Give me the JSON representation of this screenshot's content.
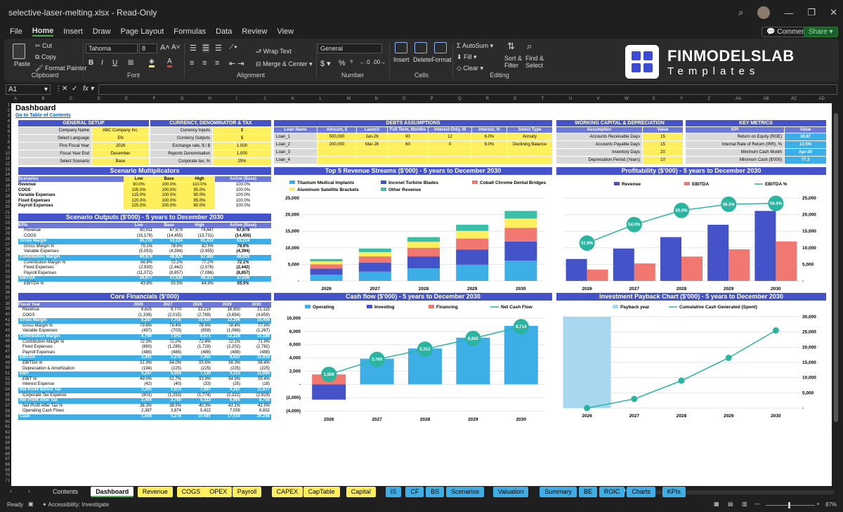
{
  "window": {
    "title": "selective-laser-melting.xlsx  -  Read-Only"
  },
  "menu": [
    "File",
    "Home",
    "Insert",
    "Draw",
    "Page Layout",
    "Formulas",
    "Data",
    "Review",
    "View"
  ],
  "menu_right": {
    "comments": "Comments",
    "share": "Share"
  },
  "ribbon": {
    "paste": "Paste",
    "cut": "Cut",
    "copy": "Copy",
    "format_painter": "Format Painter",
    "clipboard": "Clipboard",
    "font_name": "Tahoma",
    "font_size": "8",
    "font": "Font",
    "wrap": "Wrap Text",
    "merge": "Merge & Center",
    "alignment": "Alignment",
    "number_format": "General",
    "number": "Number",
    "insert": "Insert",
    "delete": "Delete",
    "format": "Format",
    "cells": "Cells",
    "autosum": "AutoSum",
    "fill": "Fill",
    "clear": "Clear",
    "sort": "Sort &",
    "filter": "Filter",
    "find": "Find &",
    "select": "Select",
    "editing": "Editing"
  },
  "logo": {
    "line1": "FINMODELSLAB",
    "line2": "Templates"
  },
  "formula": {
    "namebox": "A1"
  },
  "columns": [
    "A",
    "B",
    "C",
    "D",
    "E",
    "F",
    "G",
    "H",
    "I",
    "J",
    "K",
    "L",
    "M",
    "N",
    "O",
    "P",
    "Q",
    "R",
    "S",
    "T",
    "U",
    "V",
    "W",
    "X",
    "Y",
    "Z",
    "AA",
    "AB",
    "AC",
    "AD"
  ],
  "dashboard": {
    "title": "Dashboard",
    "toc": "Go to Table of Contents"
  },
  "general_setup": {
    "title": "GENERAL SETUP",
    "rows": [
      [
        "Company Name",
        "ABC Company Inc."
      ],
      [
        "Select Language",
        "EN"
      ],
      [
        "First Fiscal Year",
        "2026"
      ],
      [
        "Fiscal Year End",
        "December"
      ],
      [
        "Select Scenario",
        "Base"
      ]
    ]
  },
  "currency": {
    "title": "CURRENCY, DENOMINATOR & TAX",
    "rows": [
      [
        "Currency Inputs",
        "$"
      ],
      [
        "Currency Outputs",
        "$"
      ],
      [
        "Exchange rate, $ / $",
        "1.000"
      ],
      [
        "Reports Denomination",
        "1,000"
      ],
      [
        "Corporate tax, %",
        "25%"
      ]
    ]
  },
  "debts": {
    "title": "DEBTS ASSUMPTIONS",
    "headers": [
      "Loan Name",
      "Amount, $",
      "Launch",
      "Full Term, Months",
      "Interest-Only, M",
      "Interest, %",
      "Select Type"
    ],
    "rows": [
      [
        "Loan_1",
        "500,000",
        "Jan-26",
        "90",
        "12",
        "6.0%",
        "Annuity"
      ],
      [
        "Loan_2",
        "200,000",
        "Mar-26",
        "60",
        "0",
        "8.0%",
        "Declining Balance"
      ],
      [
        "Loan_3",
        "",
        "",
        "",
        "",
        "",
        ""
      ],
      [
        "Loan_4",
        "",
        "",
        "",
        "",
        "",
        ""
      ]
    ]
  },
  "working_capital": {
    "title": "WORKING CAPITAL & DEPRECIATION",
    "headers": [
      "Assumption",
      "Value"
    ],
    "rows": [
      [
        "Accounts Receivable Days",
        "15"
      ],
      [
        "Accounts Payable Days",
        "15"
      ],
      [
        "Inventory Days",
        "20"
      ],
      [
        "Depreciation Period (Years)",
        "10"
      ]
    ]
  },
  "kpis": {
    "title": "KEY METRICS",
    "headers": [
      "KPI",
      "Value"
    ],
    "rows": [
      [
        "Return on Equity (ROE)",
        "38.87"
      ],
      [
        "Internal Rate of Return (IRR), %",
        "13.5%"
      ],
      [
        "Minimum Cash Month",
        "Apr-26"
      ],
      [
        "Minimum Cash ($'000)",
        "77.3"
      ]
    ]
  },
  "multipliers": {
    "title": "Scenario Multiplicators",
    "headers": [
      "Scenarios",
      "Low",
      "Base",
      "High",
      "Active (Base)"
    ],
    "rows": [
      [
        "Revenue",
        "90.0%",
        "100.0%",
        "110.0%",
        "100.0%"
      ],
      [
        "COGS",
        "105.0%",
        "100.0%",
        "95.0%",
        "100.0%"
      ],
      [
        "Variable Expenses",
        "115.0%",
        "100.0%",
        "90.0%",
        "100.0%"
      ],
      [
        "Fixed Expenses",
        "120.0%",
        "100.0%",
        "85.0%",
        "100.0%"
      ],
      [
        "Payroll Expenses",
        "125.0%",
        "100.0%",
        "80.0%",
        "100.0%"
      ]
    ]
  },
  "outputs": {
    "title": "Scenario Outputs ($'000) - 5 years to December 2030",
    "headers": [
      "KPIs",
      "Low",
      "Base",
      "High",
      "Active (Base)"
    ],
    "rows": [
      [
        "Revenue",
        "60,911",
        "67,679",
        "74,447",
        "67,679"
      ],
      [
        "COGS",
        "(15,178)",
        "(14,455)",
        "(13,731)",
        "(14,455)"
      ],
      [
        "Gross Margin",
        "45,733",
        "53,224",
        "61,432",
        "53,224"
      ],
      [
        "Gross Margin %",
        "75.1%",
        "78.6%",
        "82.5%",
        "78.6%"
      ],
      [
        "Variable Expenses",
        "(5,053)",
        "(4,394)",
        "(3,955)",
        "(4,394)"
      ],
      [
        "Contribution Margin",
        "40,679",
        "48,829",
        "57,482",
        "48,829"
      ],
      [
        "Contribution Margin %",
        "66.8%",
        "72.1%",
        "77.2%",
        "72.1%"
      ],
      [
        "Fixed Expenses",
        "(2,930)",
        "(2,442)",
        "(2,076)",
        "(2,442)"
      ],
      [
        "Payroll Expenses",
        "(11,072)",
        "(8,857)",
        "(7,086)",
        "(8,857)"
      ],
      [
        "EBITDA",
        "26,677",
        "37,530",
        "48,321",
        "37,530"
      ],
      [
        "EBITDA %",
        "43.8%",
        "55.5%",
        "64.9%",
        "55.5%"
      ]
    ]
  },
  "core": {
    "title": "Core Financials ($'000)",
    "headers": [
      "Fiscal Year",
      "2026",
      "2027",
      "2028",
      "2029",
      "2030"
    ],
    "rows": [
      [
        "Revenue",
        "6,625",
        "9,770",
        "13,219",
        "16,950",
        "21,115"
      ],
      [
        "COGS",
        "(1,338)",
        "(2,015)",
        "(2,789)",
        "(3,654)",
        "(4,659)"
      ],
      [
        "Gross Margin",
        "5,287",
        "7,755",
        "10,430",
        "13,296",
        "16,456"
      ],
      [
        "Gross Margin %",
        "79.8%",
        "79.4%",
        "78.9%",
        "78.4%",
        "77.9%"
      ],
      [
        "Variable Expenses",
        "(497)",
        "(703)",
        "(859)",
        "(1,068)",
        "(1,267)"
      ],
      [
        "Contribution Margin",
        "4,790",
        "7,051",
        "9,571",
        "12,228",
        "15,189"
      ],
      [
        "Contribution Margin %",
        "72.3%",
        "72.2%",
        "72.4%",
        "72.1%",
        "71.9%"
      ],
      [
        "Fixed Expenses",
        "(860)",
        "(1,285)",
        "(1,728)",
        "(2,202)",
        "(2,782)"
      ],
      [
        "Payroll Expenses",
        "(488)",
        "(488)",
        "(488)",
        "(488)",
        "(488)"
      ],
      [
        "EBITDA",
        "3,441",
        "5,278",
        "7,355",
        "9,537",
        "11,918"
      ],
      [
        "EBITDA %",
        "51.9%",
        "54.0%",
        "55.6%",
        "56.3%",
        "56.4%"
      ],
      [
        "Depreciation & Amortization",
        "(194)",
        "(225)",
        "(225)",
        "(225)",
        "(225)"
      ],
      [
        "EBIT",
        "3,247",
        "5,054",
        "7,130",
        "9,313",
        "11,694"
      ],
      [
        "EBIT %",
        "49.0%",
        "51.7%",
        "53.9%",
        "54.9%",
        "55.4%"
      ],
      [
        "Interest Expense",
        "(42)",
        "(40)",
        "(33)",
        "(25)",
        "(18)"
      ],
      [
        "Net Profit Before Tax",
        "3,205",
        "5,013",
        "7,097",
        "9,287",
        "11,677"
      ],
      [
        "Corporate Tax Expense",
        "(801)",
        "(1,253)",
        "(1,774)",
        "(2,322)",
        "(2,919)"
      ],
      [
        "Net Profit After Tax",
        "2,404",
        "3,760",
        "5,323",
        "6,965",
        "8,758"
      ],
      [
        "Net Profit After Tax %",
        "36.3%",
        "38.5%",
        "40.3%",
        "41.1%",
        "41.5%"
      ],
      [
        "Operating Cash Flows",
        "2,387",
        "3,874",
        "5,422",
        "7,055",
        "8,832"
      ],
      [
        "Cash",
        "1,508",
        "5,278",
        "10,591",
        "17,533",
        "26,248"
      ]
    ]
  },
  "charts": {
    "revenue": {
      "title": "Top 5 Revenue Streams ($'000) - 5 years to December 2030",
      "legend": [
        "Titanium Medical Implants",
        "Inconel Turbine Blades",
        "Cobalt Chrome Dental Bridges",
        "Aluminum Satellite Brackets",
        "Other Revenue"
      ],
      "colors": [
        "#3eaee6",
        "#4453c8",
        "#f07870",
        "#ffef5c",
        "#3bbfa8"
      ]
    },
    "profit": {
      "title": "Profitability ($'000) - 5 years to December 2030",
      "legend": [
        "Revenue",
        "EBITDA",
        "EBITDA %"
      ],
      "colors": [
        "#4453c8",
        "#f07870",
        "#2bb5a0"
      ]
    },
    "cash": {
      "title": "Cash flow ($'000) - 5 years to December 2030",
      "legend": [
        "Operating",
        "Investing",
        "Financing",
        "Net Cash Flow"
      ],
      "colors": [
        "#3eaee6",
        "#4453c8",
        "#f07870",
        "#2bb5a0"
      ]
    },
    "payback": {
      "title": "Investment Payback Chart ($'000) - 5 years to December 2030",
      "legend": [
        "Payback year",
        "Cumulative Cash Generated (Spent)"
      ],
      "colors": [
        "#a8d8f0",
        "#2bb5a0"
      ]
    }
  },
  "chart_data": [
    {
      "type": "bar",
      "title": "Top 5 Revenue Streams ($'000) - 5 years to December 2030",
      "categories": [
        "2026",
        "2027",
        "2028",
        "2029",
        "2030"
      ],
      "stacked": true,
      "ylim": [
        0,
        25000
      ],
      "yticks": [
        "-",
        "5,000",
        "10,000",
        "15,000",
        "20,000",
        "25,000"
      ],
      "series": [
        {
          "name": "Titanium Medical Implants",
          "values": [
            1900,
            2800,
            3800,
            4900,
            6100
          ]
        },
        {
          "name": "Inconel Turbine Blades",
          "values": [
            1800,
            2700,
            3600,
            4600,
            5800
          ]
        },
        {
          "name": "Cobalt Chrome Dental Bridges",
          "values": [
            1300,
            1900,
            2600,
            3300,
            4100
          ]
        },
        {
          "name": "Aluminum Satellite Brackets",
          "values": [
            900,
            1300,
            1800,
            2300,
            2800
          ]
        },
        {
          "name": "Other Revenue",
          "values": [
            725,
            1070,
            1419,
            1850,
            2315
          ]
        }
      ]
    },
    {
      "type": "bar",
      "title": "Profitability ($'000) - 5 years to December 2030",
      "categories": [
        "2026",
        "2027",
        "2028",
        "2029",
        "2030"
      ],
      "ylim": [
        0,
        25000
      ],
      "yticks": [
        "-",
        "5,000",
        "10,000",
        "15,000",
        "20,000",
        "25,000"
      ],
      "series": [
        {
          "name": "Revenue",
          "values": [
            6625,
            9770,
            13219,
            16950,
            21115
          ]
        },
        {
          "name": "EBITDA",
          "values": [
            3441,
            5278,
            7355,
            9537,
            11918
          ]
        },
        {
          "name": "EBITDA %",
          "values": [
            51.9,
            54.0,
            55.6,
            56.3,
            56.4
          ],
          "labels": [
            "51.9%",
            "54.0%",
            "55.6%",
            "56.3%",
            "56.4%"
          ]
        }
      ]
    },
    {
      "type": "bar",
      "title": "Cash flow ($'000) - 5 years to December 2030",
      "categories": [
        "2026",
        "2027",
        "2028",
        "2029",
        "2030"
      ],
      "ylim": [
        -4000,
        10000
      ],
      "yticks": [
        "(4,000)",
        "(2,000)",
        "-",
        "2,000",
        "4,000",
        "6,000",
        "8,000",
        "10,000"
      ],
      "series": [
        {
          "name": "Operating",
          "values": [
            2387,
            3874,
            5422,
            7055,
            8832
          ]
        },
        {
          "name": "Investing",
          "values": [
            -2300,
            0,
            0,
            0,
            0
          ]
        },
        {
          "name": "Financing",
          "values": [
            1500,
            0,
            0,
            0,
            0
          ]
        },
        {
          "name": "Net Cash Flow",
          "values": [
            1508,
            3769,
            5313,
            6942,
            8714
          ],
          "labels": [
            "1,508",
            "3,769",
            "5,313",
            "6,942",
            "8,714"
          ]
        }
      ]
    },
    {
      "type": "line",
      "title": "Investment Payback Chart ($'000) - 5 years to December 2030",
      "categories": [
        "2026",
        "2027",
        "2028",
        "2029",
        "2030"
      ],
      "ylim": [
        0,
        30000
      ],
      "yticks": [
        "-",
        "5,000",
        "10,000",
        "15,000",
        "20,000",
        "25,000",
        "30,000"
      ],
      "series": [
        {
          "name": "Payback year",
          "values": [
            30000,
            0,
            0,
            0,
            0
          ]
        },
        {
          "name": "Cumulative Cash Generated (Spent)",
          "values": [
            0,
            3000,
            9000,
            16500,
            25500
          ]
        }
      ]
    }
  ],
  "tabs": [
    {
      "label": "Contents",
      "color": "#1f1f1f",
      "text": "#ddd"
    },
    {
      "label": "Dashboard",
      "color": "#ffffff",
      "text": "#000"
    },
    {
      "label": "Revenue",
      "color": "#ffef5c",
      "text": "#000"
    },
    {
      "label": "COGS",
      "color": "#ffef5c",
      "text": "#000"
    },
    {
      "label": "OPEX",
      "color": "#ffef5c",
      "text": "#000"
    },
    {
      "label": "Payroll",
      "color": "#ffef5c",
      "text": "#000"
    },
    {
      "label": "CAPEX",
      "color": "#ffef5c",
      "text": "#000"
    },
    {
      "label": "CapTable",
      "color": "#ffef5c",
      "text": "#000"
    },
    {
      "label": "Capital",
      "color": "#ffef5c",
      "text": "#000"
    },
    {
      "label": "IS",
      "color": "#3eaee6",
      "text": "#000"
    },
    {
      "label": "CF",
      "color": "#3eaee6",
      "text": "#000"
    },
    {
      "label": "BS",
      "color": "#3eaee6",
      "text": "#000"
    },
    {
      "label": "Scenarios",
      "color": "#3eaee6",
      "text": "#000"
    },
    {
      "label": "Valuation",
      "color": "#3eaee6",
      "text": "#000"
    },
    {
      "label": "Summary",
      "color": "#3eaee6",
      "text": "#000"
    },
    {
      "label": "BE",
      "color": "#3eaee6",
      "text": "#000"
    },
    {
      "label": "ROIC",
      "color": "#3eaee6",
      "text": "#000"
    },
    {
      "label": "Charts",
      "color": "#3eaee6",
      "text": "#000"
    },
    {
      "label": "KPIs",
      "color": "#3eaee6",
      "text": "#000"
    }
  ],
  "status": {
    "ready": "Ready",
    "accessibility": "Accessibility: Investigate",
    "zoom": "87%"
  }
}
